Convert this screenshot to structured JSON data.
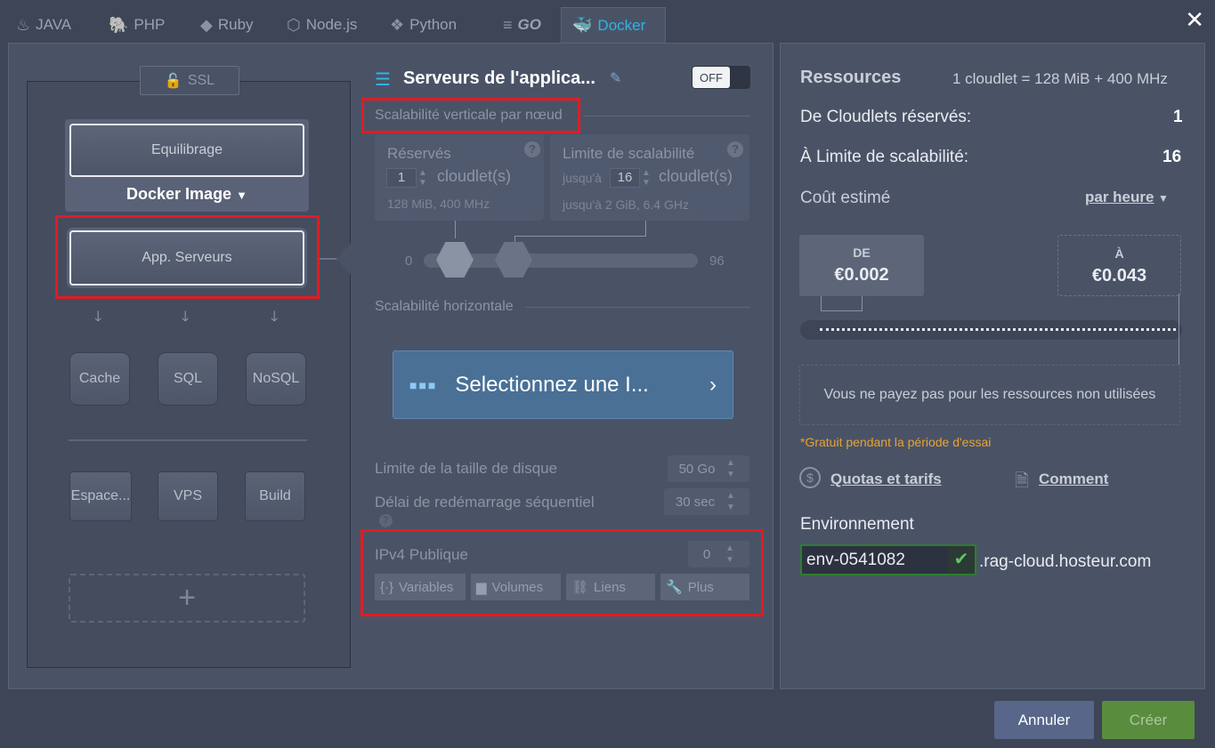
{
  "tabs": [
    {
      "label": "JAVA",
      "icon": "java-icon"
    },
    {
      "label": "PHP",
      "icon": "php-icon"
    },
    {
      "label": "Ruby",
      "icon": "ruby-icon"
    },
    {
      "label": "Node.js",
      "icon": "nodejs-icon"
    },
    {
      "label": "Python",
      "icon": "python-icon"
    },
    {
      "label": "GO",
      "icon": "go-icon"
    },
    {
      "label": "Docker",
      "icon": "docker-icon"
    }
  ],
  "topology": {
    "ssl": "SSL",
    "balancer": "Equilibrage",
    "docker_image": "Docker Image",
    "app_servers": "App. Serveurs",
    "cache": "Cache",
    "sql": "SQL",
    "nosql": "NoSQL",
    "storage": "Espace...",
    "vps": "VPS",
    "build": "Build",
    "add": "+"
  },
  "config": {
    "title": "Serveurs de l'applica...",
    "toggle": "OFF",
    "vertical_label": "Scalabilité verticale par nœud",
    "reserved_title": "Réservés",
    "reserved_value": "1",
    "reserved_unit": "cloudlet(s)",
    "reserved_sub": "128 MiB, 400 MHz",
    "limit_title": "Limite de scalabilité",
    "limit_prefix": "jusqu'à",
    "limit_value": "16",
    "limit_unit": "cloudlet(s)",
    "limit_sub": "jusqu'à 2 GiB, 6.4 GHz",
    "slider_min": "0",
    "slider_max": "96",
    "horizontal_label": "Scalabilité horizontale",
    "select_image": "Selectionnez une I...",
    "disk_label": "Limite de la taille de disque",
    "disk_value": "50 Go",
    "restart_label": "Délai de redémarrage séquentiel",
    "restart_value": "30 sec",
    "ipv4_label": "IPv4 Publique",
    "ipv4_value": "0",
    "btn_variables": "Variables",
    "btn_volumes": "Volumes",
    "btn_links": "Liens",
    "btn_more": "Plus"
  },
  "resources": {
    "title": "Ressources",
    "cloudlet_def": "1 cloudlet = 128 MiB + 400 MHz",
    "reserved_label": "De Cloudlets réservés:",
    "reserved_value": "1",
    "limit_label": "À Limite de scalabilité:",
    "limit_value": "16",
    "cost_label": "Coût estimé",
    "period": "par heure",
    "from_label": "DE",
    "from_value": "€0.002",
    "to_label": "À",
    "to_value": "€0.043",
    "note": "Vous ne payez pas pour les ressources non utilisées",
    "trial": "*Gratuit pendant la période d'essai",
    "quotas": "Quotas et tarifs",
    "how": "Comment",
    "env_label": "Environnement",
    "env_name": "env-0541082",
    "env_domain": ".rag-cloud.hosteur.com"
  },
  "footer": {
    "cancel": "Annuler",
    "create": "Créer"
  }
}
